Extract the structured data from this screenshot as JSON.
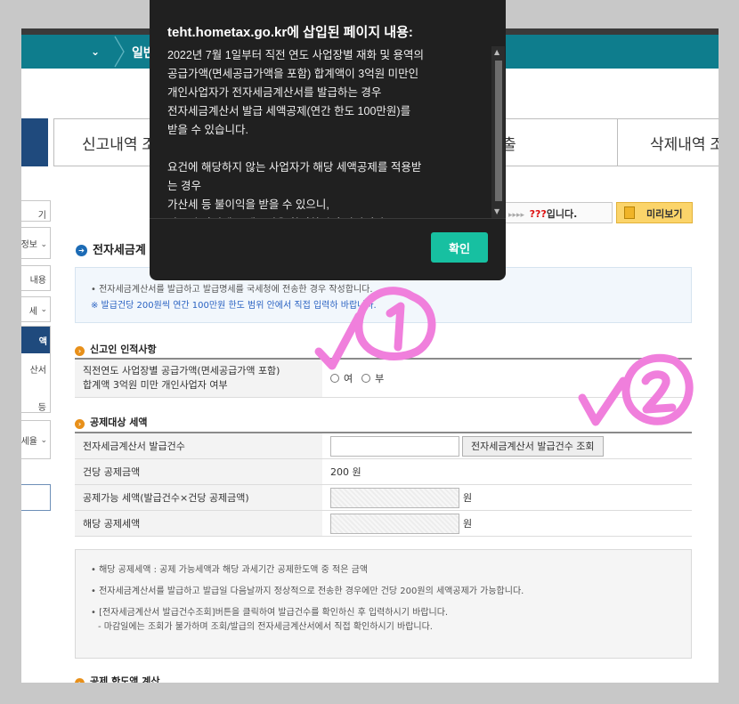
{
  "nav": {
    "dropdown_glyph": "⌄",
    "current_label": "일반"
  },
  "tabs": [
    {
      "label": "신고내역 조"
    },
    {
      "label": "출"
    },
    {
      "label": "삭제내역 조"
    }
  ],
  "sidebar": [
    {
      "label": "기"
    },
    {
      "label": "정보"
    },
    {
      "label": "내용"
    },
    {
      "label": "세"
    },
    {
      "label": "액"
    },
    {
      "label": "산서"
    },
    {
      "label": "등"
    },
    {
      "label": "세율"
    }
  ],
  "status_pill": {
    "arrows": "▸▸▸▸",
    "code": "???",
    "suffix": "입니다."
  },
  "preview_button": {
    "label": "미리보기"
  },
  "section": {
    "title": "전자세금계"
  },
  "info_box": {
    "line1": "• 전자세금계산서를 발급하고 발급명세를 국세청에 전송한 경우 작성합니다.",
    "line2": "※ 발급건당 200원씩 연간 100만원 한도 범위 안에서 직접 입력하",
    "line2_tail": "바랍니다."
  },
  "declarant": {
    "heading": "신고인 인적사항",
    "question_line1": "직전연도 사업장별 공급가액(면세공급가액 포함)",
    "question_line2": "합계액 3억원 미만 개인사업자 여부",
    "option_yes": "여",
    "option_no": "부"
  },
  "deduction": {
    "heading": "공제대상 세액",
    "rows": [
      {
        "label": "전자세금계산서 발급건수",
        "button": "전자세금계산서 발급건수 조회"
      },
      {
        "label": "건당 공제금액",
        "value": "200 원"
      },
      {
        "label": "공제가능 세액(발급건수×건당 공제금액)",
        "unit": "원"
      },
      {
        "label": "해당 공제세액",
        "unit": "원"
      }
    ]
  },
  "notes": {
    "n1": "• 해당 공제세액 : 공제 가능세액과 해당 과세기간 공제한도액 중 적은 금액",
    "n2": "• 전자세금계산서를 발급하고 발급일 다음날까지 정상적으로 전송한 경우에만 건당 200원의 세액공제가 가능합니다.",
    "n3a": "• [전자세금계산서 발급건수조회]버튼을 클릭하여 발급건수를 확인하신 후 입력하시기 바랍니다.",
    "n3b": "- 마감일에는 조회가 불가하며 조회/발급의 전자세금계산서에서 직접 확인하시기 바랍니다."
  },
  "bottom_heading": "공제 한도액 계산",
  "dialog": {
    "title": "teht.hometax.go.kr에 삽입된 페이지 내용:",
    "body": "2022년 7월 1일부터 직전 연도 사업장별 재화 및 용역의\n공급가액(면세공급가액을 포함) 합계액이 3억원 미만인\n개인사업자가 전자세금계산서를 발급하는 경우\n전자세금계산서 발급 세액공제(연간 한도 100만원)를\n받을 수 있습니다.\n\n요건에 해당하지 않는 사업자가 해당 세액공제를 적용받\n는 경우\n가산세 등 불이익을 받을 수 있으니,\n반드시 사전에 공제요건을 확인하시기 바랍니다.",
    "ok_label": "확인"
  },
  "annotations": {
    "mark1": "v①",
    "mark2": "v②",
    "color": "#f07fdc"
  },
  "colors": {
    "nav": "#0e7d8d",
    "ok_button": "#17c0a1",
    "dialog_bg": "#202020",
    "preview": "#fbd46a"
  }
}
